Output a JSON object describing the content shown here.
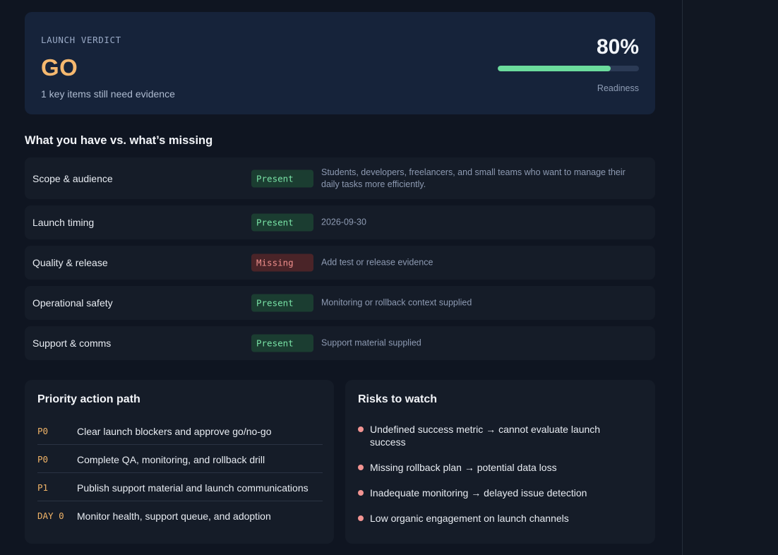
{
  "verdict": {
    "kicker": "LAUNCH VERDICT",
    "value": "GO",
    "note": "1 key items still need evidence",
    "score": "80%",
    "readiness": 0.8,
    "score_label": "Readiness"
  },
  "checklist": {
    "title": "What you have vs. what’s missing",
    "rows": [
      {
        "name": "Scope & audience",
        "status": "Present",
        "detail": "Students, developers, freelancers, and small teams who want to manage their daily tasks more efficiently."
      },
      {
        "name": "Launch timing",
        "status": "Present",
        "detail": "2026-09-30"
      },
      {
        "name": "Quality & release",
        "status": "Missing",
        "detail": "Add test or release evidence"
      },
      {
        "name": "Operational safety",
        "status": "Present",
        "detail": "Monitoring or rollback context supplied"
      },
      {
        "name": "Support & comms",
        "status": "Present",
        "detail": "Support material supplied"
      }
    ]
  },
  "actions": {
    "title": "Priority action path",
    "items": [
      {
        "tag": "P0",
        "text": "Clear launch blockers and approve go/no-go"
      },
      {
        "tag": "P0",
        "text": "Complete QA, monitoring, and rollback drill"
      },
      {
        "tag": "P1",
        "text": "Publish support material and launch communications"
      },
      {
        "tag": "DAY 0",
        "text": "Monitor health, support queue, and adoption"
      }
    ]
  },
  "risks": {
    "title": "Risks to watch",
    "items": [
      "Undefined success metric → cannot evaluate launch success",
      "Missing rollback plan → potential data loss",
      "Inadequate monitoring → delayed issue detection",
      "Low organic engagement on launch channels"
    ]
  },
  "colors": {
    "accent": "#f5b86f",
    "present": "#79e3a6",
    "missing": "#f08f8c",
    "progress": "#6bdb9c"
  }
}
